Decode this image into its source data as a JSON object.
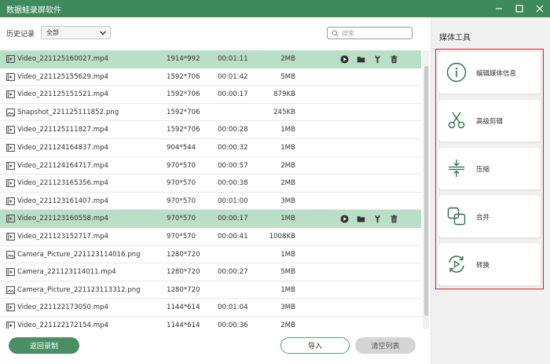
{
  "app": {
    "title": "数据蛙录屏软件"
  },
  "toolbar": {
    "history_label": "历史记录",
    "filter_value": "全部",
    "search_placeholder": "搜索"
  },
  "files": [
    {
      "name": "Video_221125160027.mp4",
      "type": "video",
      "resolution": "1914*992",
      "duration": "00:01:11",
      "size": "2MB",
      "selected": true
    },
    {
      "name": "Video_221125155629.mp4",
      "type": "video",
      "resolution": "1592*706",
      "duration": "00:01:42",
      "size": "5MB",
      "selected": false
    },
    {
      "name": "Video_221125151521.mp4",
      "type": "video",
      "resolution": "1592*706",
      "duration": "00:00:17",
      "size": "879KB",
      "selected": false
    },
    {
      "name": "Snapshot_221125111852.png",
      "type": "image",
      "resolution": "1592*706",
      "duration": "",
      "size": "245KB",
      "selected": false
    },
    {
      "name": "Video_221125111827.mp4",
      "type": "video",
      "resolution": "1592*706",
      "duration": "00:00:28",
      "size": "1MB",
      "selected": false
    },
    {
      "name": "Video_221124164837.mp4",
      "type": "video",
      "resolution": "904*544",
      "duration": "00:00:32",
      "size": "1MB",
      "selected": false
    },
    {
      "name": "Video_221124164717.mp4",
      "type": "video",
      "resolution": "970*570",
      "duration": "00:00:57",
      "size": "2MB",
      "selected": false
    },
    {
      "name": "Video_221123165356.mp4",
      "type": "video",
      "resolution": "970*570",
      "duration": "00:00:38",
      "size": "2MB",
      "selected": false
    },
    {
      "name": "Video_221123161407.mp4",
      "type": "video",
      "resolution": "970*570",
      "duration": "00:01:00",
      "size": "3MB",
      "selected": false
    },
    {
      "name": "Video_221123160558.mp4",
      "type": "video",
      "resolution": "970*570",
      "duration": "00:00:17",
      "size": "1MB",
      "selected": true
    },
    {
      "name": "Video_221123152717.mp4",
      "type": "video",
      "resolution": "970*570",
      "duration": "00:00:41",
      "size": "1008KB",
      "selected": false
    },
    {
      "name": "Camera_Picture_221123114016.png",
      "type": "image",
      "resolution": "1280*720",
      "duration": "",
      "size": "1MB",
      "selected": false
    },
    {
      "name": "Camera_221123114011.mp4",
      "type": "video",
      "resolution": "1280*720",
      "duration": "00:00:27",
      "size": "5MB",
      "selected": false
    },
    {
      "name": "Camera_Picture_221123113312.png",
      "type": "image",
      "resolution": "1280*720",
      "duration": "",
      "size": "1MB",
      "selected": false
    },
    {
      "name": "Video_221122173050.mp4",
      "type": "video",
      "resolution": "1144*614",
      "duration": "00:01:04",
      "size": "3MB",
      "selected": false
    },
    {
      "name": "Video_221122172154.mp4",
      "type": "video",
      "resolution": "1144*614",
      "duration": "00:00:36",
      "size": "2MB",
      "selected": false
    }
  ],
  "row_actions": [
    "play-icon",
    "folder-icon",
    "tool-icon",
    "trash-icon"
  ],
  "bottom": {
    "back_label": "返回录制",
    "import_label": "导入",
    "clear_label": "清空列表"
  },
  "media_tools": {
    "title": "媒体工具",
    "items": [
      {
        "label": "编辑媒体信息",
        "icon": "info-icon"
      },
      {
        "label": "高级剪辑",
        "icon": "scissors-icon"
      },
      {
        "label": "压缩",
        "icon": "compress-icon"
      },
      {
        "label": "合并",
        "icon": "merge-icon"
      },
      {
        "label": "转换",
        "icon": "convert-icon"
      }
    ]
  },
  "colors": {
    "accent": "#3f8a5d",
    "selected_row": "#b9dfc7",
    "highlight_border": "#e32020"
  }
}
